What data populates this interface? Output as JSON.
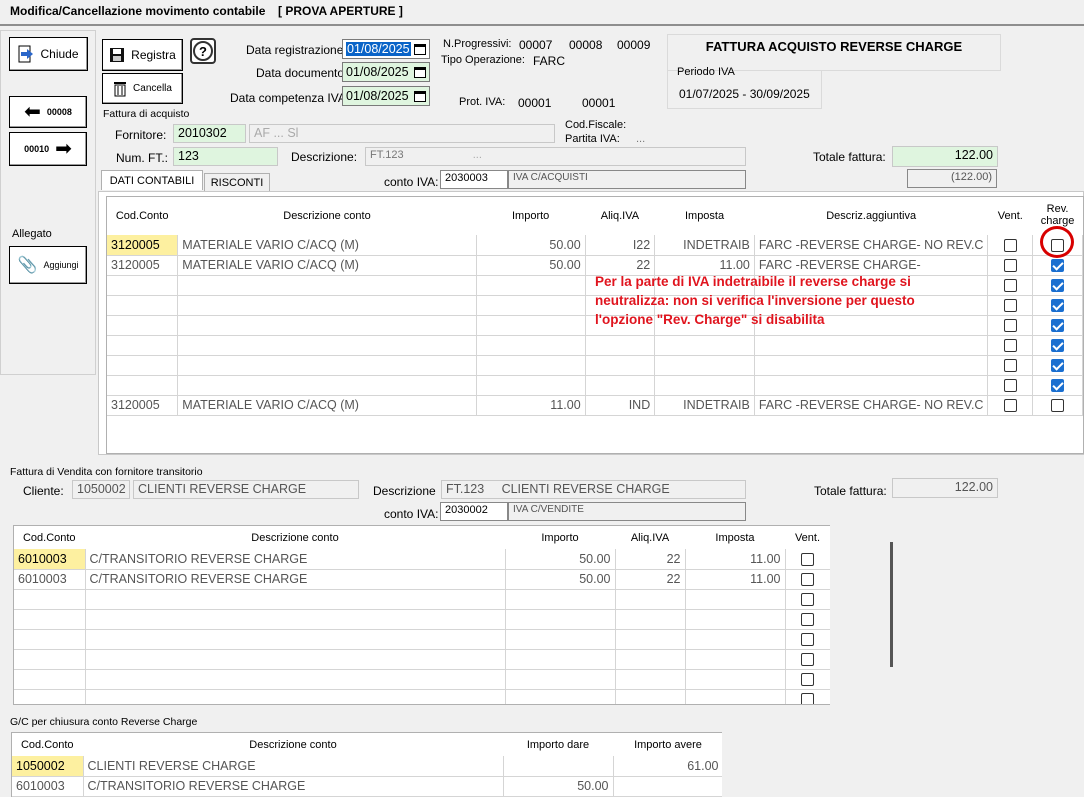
{
  "window": {
    "title": "Modifica/Cancellazione movimento contabile",
    "subtitle": "[ PROVA APERTURE ]"
  },
  "toolbar": {
    "chiude": "Chiude",
    "registra": "Registra",
    "cancella": "Cancella",
    "prev_label": "00008",
    "next_label": "00010",
    "help": "?"
  },
  "allegato": {
    "label": "Allegato",
    "aggiungi": "Aggiungi"
  },
  "dates": {
    "registrazione_label": "Data registrazione:",
    "registrazione": "01/08/2025",
    "documento_label": "Data documento:",
    "documento": "01/08/2025",
    "competenza_label": "Data competenza IVA:",
    "competenza": "01/08/2025"
  },
  "progressivi": {
    "label": "N.Progressivi:",
    "v1": "00007",
    "v2": "00008",
    "v3": "00009",
    "tipo_label": "Tipo Operazione:",
    "tipo": "FARC",
    "prot_label": "Prot. IVA:",
    "prot1": "00001",
    "prot2": "00001"
  },
  "header_right": {
    "title": "FATTURA ACQUISTO REVERSE CHARGE",
    "periodo_label": "Periodo IVA",
    "periodo": "01/07/2025 - 30/09/2025"
  },
  "acquisto": {
    "section": "Fattura di acquisto",
    "fornitore_label": "Fornitore:",
    "fornitore_code": "2010302",
    "fornitore_name": "AF ... Sl",
    "codfisc_label": "Cod.Fiscale:",
    "piva_label": "Partita IVA:",
    "piva_value": "...",
    "numft_label": "Num. FT.:",
    "numft": "123",
    "descr_label": "Descrizione:",
    "descr": "FT.123",
    "descr_hidden": "...",
    "totale_label": "Totale fattura:",
    "totale": "122.00",
    "totale2": "(122.00)",
    "conto_iva_label": "conto IVA:",
    "conto_iva": "2030003",
    "conto_iva_desc": "IVA C/ACQUISTI"
  },
  "tabs": [
    {
      "label": "DATI CONTABILI"
    },
    {
      "label": "RISCONTI"
    }
  ],
  "grid1": {
    "headers": [
      "Cod.Conto",
      "Descrizione conto",
      "Importo",
      "Aliq.IVA",
      "Imposta",
      "Descriz.aggiuntiva",
      "Vent.",
      "Rev. charge"
    ],
    "rows": [
      {
        "cod": "3120005",
        "desc": "MATERIALE VARIO C/ACQ (M)",
        "imp": "50.00",
        "aliq": "I22",
        "imposta": "INDETRAIB",
        "agg": "FARC -REVERSE CHARGE- NO REV.C",
        "vent": false,
        "rev": false,
        "hl": true
      },
      {
        "cod": "3120005",
        "desc": "MATERIALE VARIO C/ACQ (M)",
        "imp": "50.00",
        "aliq": "22",
        "imposta": "11.00",
        "agg": "FARC -REVERSE CHARGE-",
        "vent": false,
        "rev": true,
        "hl": false
      },
      {
        "cod": "",
        "desc": "",
        "imp": "",
        "aliq": "",
        "imposta": "",
        "agg": "",
        "vent": false,
        "rev": true,
        "hl": false
      },
      {
        "cod": "",
        "desc": "",
        "imp": "",
        "aliq": "",
        "imposta": "",
        "agg": "",
        "vent": false,
        "rev": true,
        "hl": false
      },
      {
        "cod": "",
        "desc": "",
        "imp": "",
        "aliq": "",
        "imposta": "",
        "agg": "",
        "vent": false,
        "rev": true,
        "hl": false
      },
      {
        "cod": "",
        "desc": "",
        "imp": "",
        "aliq": "",
        "imposta": "",
        "agg": "",
        "vent": false,
        "rev": true,
        "hl": false
      },
      {
        "cod": "",
        "desc": "",
        "imp": "",
        "aliq": "",
        "imposta": "",
        "agg": "",
        "vent": false,
        "rev": true,
        "hl": false
      },
      {
        "cod": "",
        "desc": "",
        "imp": "",
        "aliq": "",
        "imposta": "",
        "agg": "",
        "vent": false,
        "rev": true,
        "hl": false
      },
      {
        "cod": "3120005",
        "desc": "MATERIALE VARIO C/ACQ (M)",
        "imp": "11.00",
        "aliq": "IND",
        "imposta": "INDETRAIB",
        "agg": "FARC -REVERSE CHARGE- NO REV.C",
        "vent": false,
        "rev": false,
        "hl": false
      }
    ]
  },
  "annotation": "Per la parte di IVA indetraibile il reverse charge si neutralizza: non si verifica l'inversione per questo l'opzione \"Rev. Charge\" si disabilita",
  "vendita": {
    "section": "Fattura di Vendita con fornitore transitorio",
    "cliente_label": "Cliente:",
    "cliente_code": "1050002",
    "cliente_name": "CLIENTI REVERSE CHARGE",
    "descr_label": "Descrizione",
    "descr": "FT.123     CLIENTI REVERSE CHARGE",
    "totale_label": "Totale fattura:",
    "totale": "122.00",
    "conto_iva_label": "conto IVA:",
    "conto_iva": "2030002",
    "conto_iva_desc": "IVA C/VENDITE"
  },
  "grid2": {
    "headers": [
      "Cod.Conto",
      "Descrizione conto",
      "Importo",
      "Aliq.IVA",
      "Imposta",
      "Vent."
    ],
    "rows": [
      {
        "cod": "6010003",
        "desc": "C/TRANSITORIO REVERSE CHARGE",
        "imp": "50.00",
        "aliq": "22",
        "imposta": "11.00",
        "hl": true
      },
      {
        "cod": "6010003",
        "desc": "C/TRANSITORIO REVERSE CHARGE",
        "imp": "50.00",
        "aliq": "22",
        "imposta": "11.00",
        "hl": false
      },
      {
        "cod": "",
        "desc": "",
        "imp": "",
        "aliq": "",
        "imposta": "",
        "hl": false
      },
      {
        "cod": "",
        "desc": "",
        "imp": "",
        "aliq": "",
        "imposta": "",
        "hl": false
      },
      {
        "cod": "",
        "desc": "",
        "imp": "",
        "aliq": "",
        "imposta": "",
        "hl": false
      },
      {
        "cod": "",
        "desc": "",
        "imp": "",
        "aliq": "",
        "imposta": "",
        "hl": false
      },
      {
        "cod": "",
        "desc": "",
        "imp": "",
        "aliq": "",
        "imposta": "",
        "hl": false
      },
      {
        "cod": "",
        "desc": "",
        "imp": "",
        "aliq": "",
        "imposta": "",
        "hl": false
      }
    ]
  },
  "gc": {
    "section": "G/C per chiusura conto Reverse Charge",
    "headers": [
      "Cod.Conto",
      "Descrizione conto",
      "Importo dare",
      "Importo avere"
    ],
    "rows": [
      {
        "cod": "1050002",
        "desc": "CLIENTI REVERSE CHARGE",
        "dare": "",
        "avere": "61.00",
        "hl": true
      },
      {
        "cod": "6010003",
        "desc": "C/TRANSITORIO REVERSE CHARGE",
        "dare": "50.00",
        "avere": "",
        "hl": false
      }
    ]
  }
}
